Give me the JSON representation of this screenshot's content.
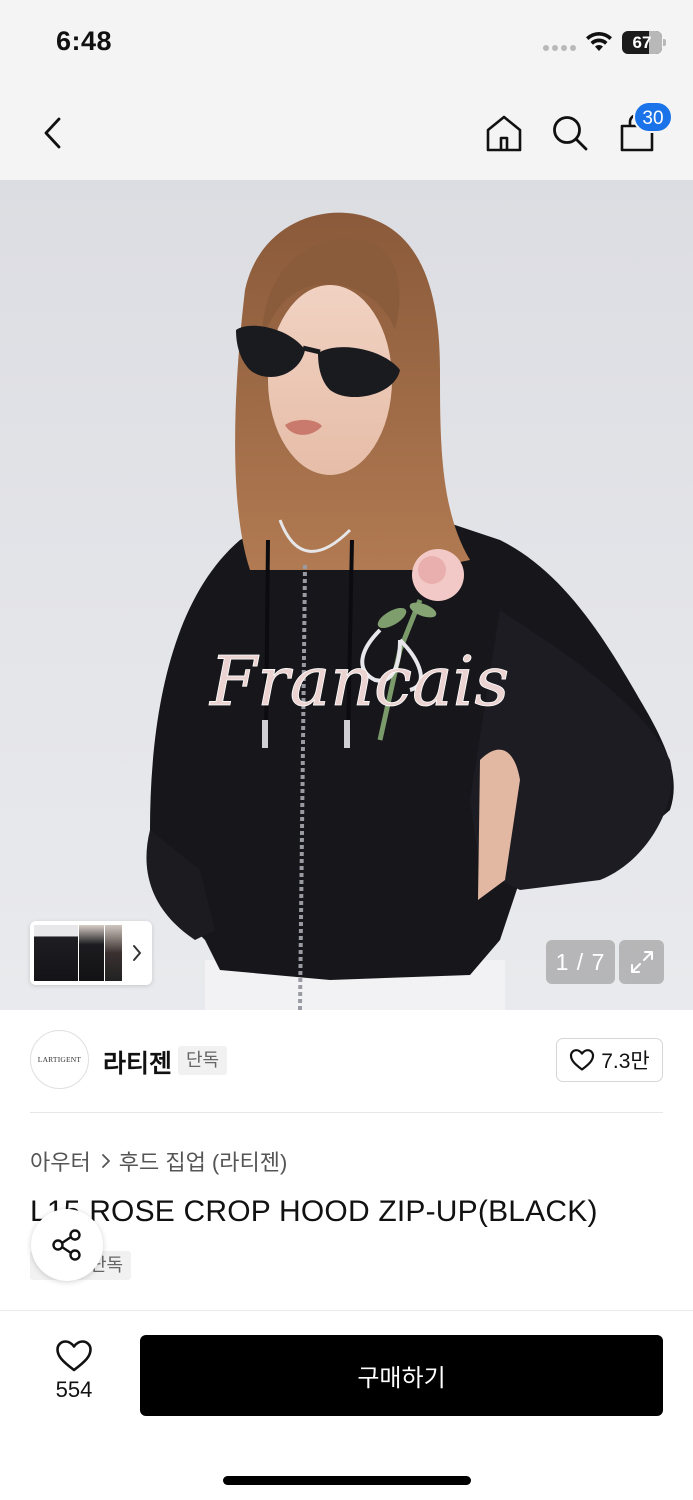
{
  "status_bar": {
    "time": "6:48",
    "battery_level": "67",
    "battery_fraction": 0.67,
    "icons": [
      "signal-dots-icon",
      "wifi-icon",
      "battery-icon"
    ]
  },
  "nav": {
    "icons": [
      "back-chevron-icon",
      "home-icon",
      "search-icon",
      "shopping-bag-icon"
    ],
    "cart_count": "30",
    "badge_color": "#1a73e8"
  },
  "gallery": {
    "current_page": "1 / 7",
    "image_description_icon": "product-photo",
    "thumbnail_chevron_icon": "chevron-right-icon",
    "expand_icon": "expand-icon"
  },
  "brand": {
    "logo_text": "LARTIGENT",
    "name": "라티젠",
    "exclusive_label": "단독",
    "like_count": "7.3만"
  },
  "product": {
    "breadcrumb": [
      "아우터",
      "후드 집업 (라티젠)"
    ],
    "title": "L15 ROSE CROP HOOD ZIP-UP(BLACK)",
    "exclusive_label": "단독",
    "share_icon": "share-icon"
  },
  "bottom_bar": {
    "wish_count": "554",
    "buy_label": "구매하기",
    "buy_color": "#000000"
  }
}
